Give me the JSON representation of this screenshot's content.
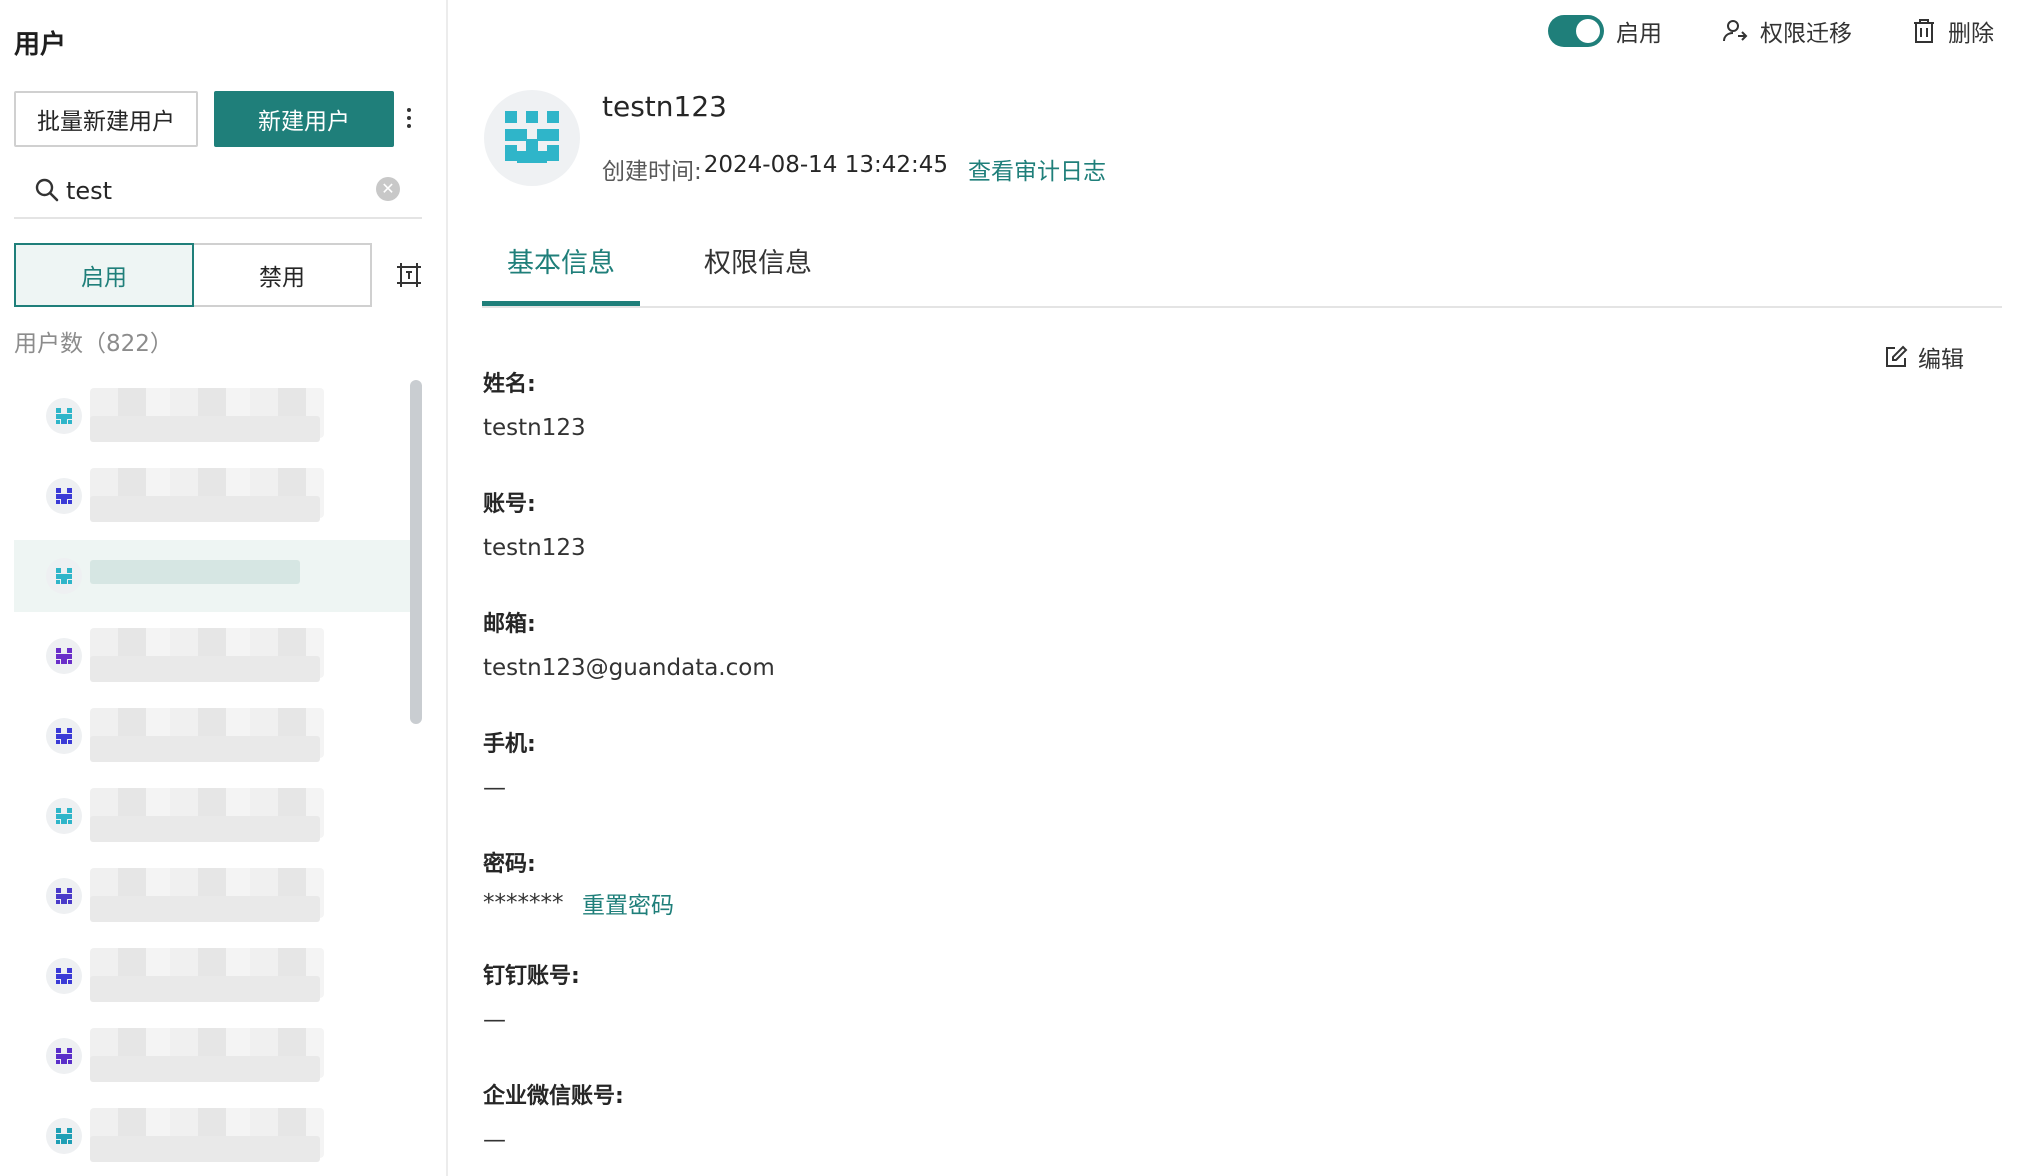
{
  "sidebar": {
    "title": "用户",
    "batch_create": "批量新建用户",
    "create": "新建用户",
    "search_value": "test",
    "filter_enabled": "启用",
    "filter_disabled": "禁用",
    "user_count": "用户数（822）",
    "users": [
      {
        "avatar_color": "#2fb5c9",
        "selected": false
      },
      {
        "avatar_color": "#3b3bd6",
        "selected": false
      },
      {
        "avatar_color": "#2fb5c9",
        "selected": true
      },
      {
        "avatar_color": "#6a2fc9",
        "selected": false
      },
      {
        "avatar_color": "#3b3bd6",
        "selected": false
      },
      {
        "avatar_color": "#2fb5c9",
        "selected": false
      },
      {
        "avatar_color": "#4a3bc9",
        "selected": false
      },
      {
        "avatar_color": "#3b3bd6",
        "selected": false
      },
      {
        "avatar_color": "#5a2fc9",
        "selected": false
      },
      {
        "avatar_color": "#1f9fb5",
        "selected": false
      }
    ]
  },
  "topbar": {
    "status_label": "启用",
    "status_on": true,
    "transfer": "权限迁移",
    "delete": "删除"
  },
  "user": {
    "name": "testn123",
    "created_label": "创建时间:",
    "created_value": "2024-08-14 13:42:45",
    "audit_log": "查看审计日志"
  },
  "tabs": {
    "basic": "基本信息",
    "permission": "权限信息"
  },
  "edit_label": "编辑",
  "fields": {
    "name_label": "姓名:",
    "name_value": "testn123",
    "account_label": "账号:",
    "account_value": "testn123",
    "email_label": "邮箱:",
    "email_value": "testn123@guandata.com",
    "phone_label": "手机:",
    "phone_value": "—",
    "password_label": "密码:",
    "password_value": "*******",
    "reset_password": "重置密码",
    "dingtalk_label": "钉钉账号:",
    "dingtalk_value": "—",
    "wecom_label": "企业微信账号:",
    "wecom_value": "—"
  },
  "colors": {
    "accent": "#1f7f7a",
    "selected_row": "#eef5f3",
    "avatar_main": "#2fb5c9"
  },
  "icons": [
    "search-icon",
    "clear-icon",
    "more-icon",
    "expand-icon",
    "user-transfer-icon",
    "trash-icon",
    "edit-icon"
  ]
}
